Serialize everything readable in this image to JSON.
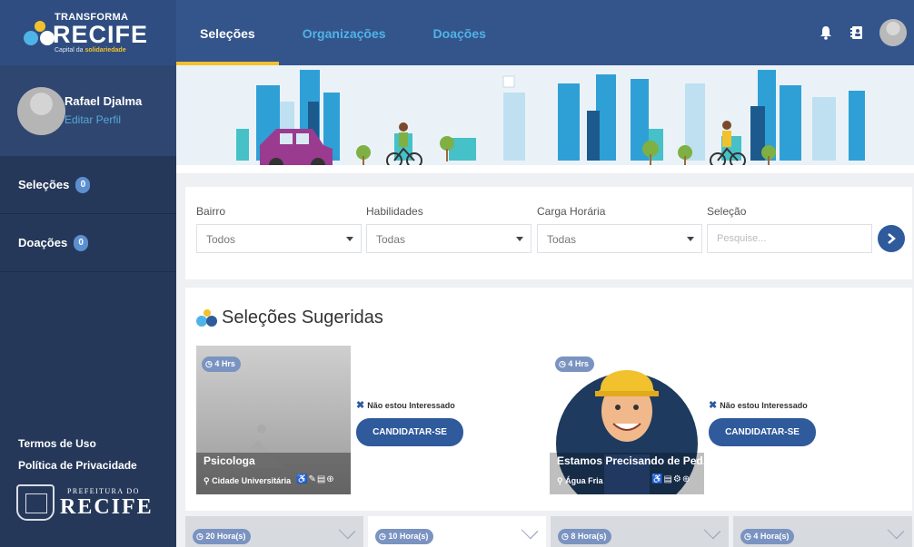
{
  "brand": {
    "line1": "TRANSFORMA",
    "line2": "RECIFE",
    "tagline_prefix": "Capital da ",
    "tagline_strong": "solidariedade"
  },
  "nav": {
    "tabs": [
      {
        "label": "Seleções"
      },
      {
        "label": "Organizações"
      },
      {
        "label": "Doações"
      }
    ]
  },
  "header_icons": [
    "bell-icon",
    "contacts-icon"
  ],
  "profile": {
    "name": "Rafael Djalma",
    "edit_label": "Editar Perfil"
  },
  "sidebar": {
    "items": [
      {
        "label": "Seleções",
        "count": "0"
      },
      {
        "label": "Doações",
        "count": "0"
      }
    ],
    "links": [
      {
        "label": "Termos de Uso"
      },
      {
        "label": "Política de Privacidade"
      }
    ],
    "prefeitura": {
      "line1": "PREFEITURA DO",
      "line2": "RECIFE"
    }
  },
  "filters": {
    "bairro": {
      "label": "Bairro",
      "value": "Todos"
    },
    "habilidades": {
      "label": "Habilidades",
      "value": "Todas"
    },
    "carga": {
      "label": "Carga Horária",
      "value": "Todas"
    },
    "selecao": {
      "label": "Seleção",
      "placeholder": "Pesquise..."
    }
  },
  "suggestions": {
    "title": "Seleções Sugeridas",
    "not_interested": "Não estou Interessado",
    "apply": "CANDIDATAR-SE",
    "cards": [
      {
        "hours": "4 Hrs",
        "title": "Psicologa",
        "location": "Cidade Universitária"
      },
      {
        "hours": "4 Hrs",
        "title": "Estamos Precisando de Ped...",
        "location": "Água Fria"
      }
    ]
  },
  "bottom_cards": [
    {
      "hours": "20 Hora(s)"
    },
    {
      "hours": "10 Hora(s)"
    },
    {
      "hours": "8 Hora(s)"
    },
    {
      "hours": "4 Hora(s)"
    }
  ],
  "colors": {
    "topbar": "#34558b",
    "sidebar": "#26385a",
    "accent": "#f2c12e",
    "primary_button": "#2f5a9c",
    "link": "#4fb3e8"
  }
}
